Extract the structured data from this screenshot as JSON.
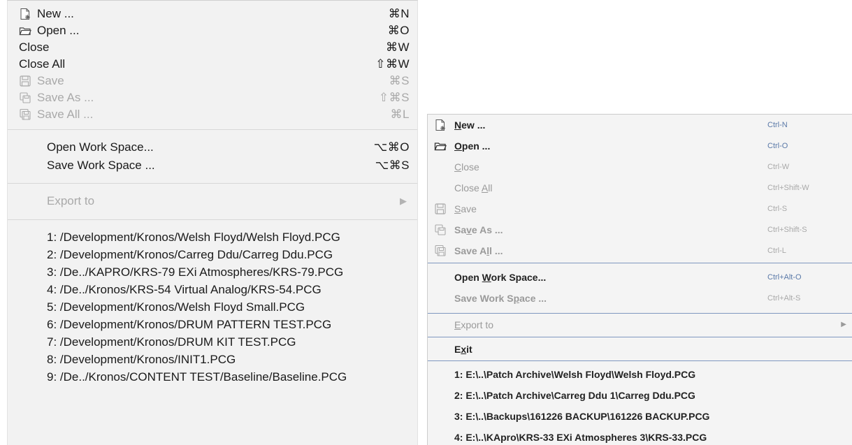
{
  "mac_menu": {
    "new": {
      "label": "New ...",
      "shortcut": "⌘N"
    },
    "open": {
      "label": "Open ...",
      "shortcut": "⌘O"
    },
    "close": {
      "label": "Close",
      "shortcut": "⌘W"
    },
    "close_all": {
      "label": "Close All",
      "shortcut": "⇧⌘W"
    },
    "save": {
      "label": "Save",
      "shortcut": "⌘S"
    },
    "save_as": {
      "label": "Save As ...",
      "shortcut": "⇧⌘S"
    },
    "save_all": {
      "label": "Save All ...",
      "shortcut": "⌘L"
    },
    "open_workspace": {
      "label": "Open Work Space...",
      "shortcut": "⌥⌘O"
    },
    "save_workspace": {
      "label": "Save Work Space ...",
      "shortcut": "⌥⌘S"
    },
    "export_to": {
      "label": "Export to"
    },
    "recent_files": [
      "1: /Development/Kronos/Welsh Floyd/Welsh Floyd.PCG",
      "2: /Development/Kronos/Carreg Ddu/Carreg Ddu.PCG",
      "3: /De../KAPRO/KRS-79 EXi Atmospheres/KRS-79.PCG",
      "4: /De../Kronos/KRS-54 Virtual Analog/KRS-54.PCG",
      "5: /Development/Kronos/Welsh Floyd Small.PCG",
      "6: /Development/Kronos/DRUM PATTERN TEST.PCG",
      "7: /Development/Kronos/DRUM KIT TEST.PCG",
      "8: /Development/Kronos/INIT1.PCG",
      "9: /De../Kronos/CONTENT TEST/Baseline/Baseline.PCG"
    ]
  },
  "win_menu": {
    "new": {
      "pre": "",
      "mn": "N",
      "post": "ew ...",
      "shortcut": "Ctrl-N"
    },
    "open": {
      "pre": "",
      "mn": "O",
      "post": "pen ...",
      "shortcut": "Ctrl-O"
    },
    "close": {
      "pre": "",
      "mn": "C",
      "post": "lose",
      "shortcut": "Ctrl-W"
    },
    "close_all": {
      "pre": "Close ",
      "mn": "A",
      "post": "ll",
      "shortcut": "Ctrl+Shift-W"
    },
    "save": {
      "pre": "",
      "mn": "S",
      "post": "ave",
      "shortcut": "Ctrl-S"
    },
    "save_as": {
      "pre": "Sa",
      "mn": "v",
      "post": "e As ...",
      "shortcut": "Ctrl+Shift-S"
    },
    "save_all": {
      "pre": "Save A",
      "mn": "l",
      "post": "l ...",
      "shortcut": "Ctrl-L"
    },
    "open_workspace": {
      "pre": "Open ",
      "mn": "W",
      "post": "ork Space...",
      "shortcut": "Ctrl+Alt-O"
    },
    "save_workspace": {
      "pre": "Save Work S",
      "mn": "p",
      "post": "ace ...",
      "shortcut": "Ctrl+Alt-S"
    },
    "export_to": {
      "pre": "",
      "mn": "E",
      "post": "xport to"
    },
    "exit": {
      "pre": "E",
      "mn": "x",
      "post": "it"
    },
    "recent_files": [
      "1: E:\\..\\Patch Archive\\Welsh Floyd\\Welsh Floyd.PCG",
      "2: E:\\..\\Patch Archive\\Carreg Ddu 1\\Carreg Ddu.PCG",
      "3: E:\\..\\Backups\\161226 BACKUP\\161226 BACKUP.PCG",
      "4: E:\\..\\KApro\\KRS-33 EXi Atmospheres 3\\KRS-33.PCG"
    ]
  }
}
